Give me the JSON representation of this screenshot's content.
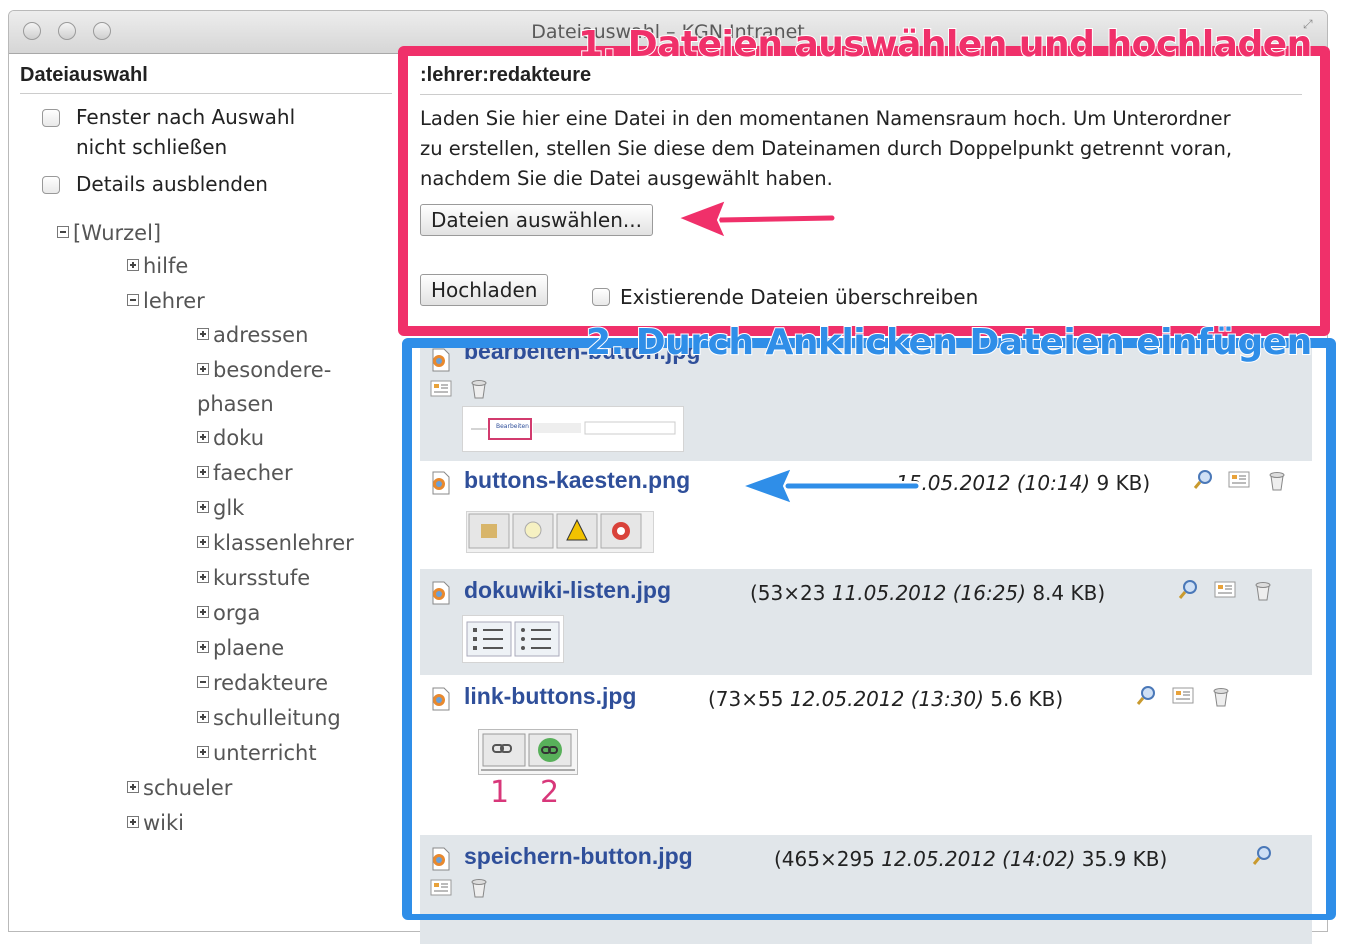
{
  "window": {
    "title": "Dateiauswahl – KGN Intranet"
  },
  "left": {
    "title": "Dateiauswahl",
    "options": [
      {
        "label_1": "Fenster nach Auswahl",
        "label_2": "nicht schließen"
      },
      {
        "label_1": "Details ausblenden"
      }
    ],
    "tree": {
      "root": "[Wurzel]",
      "hilfe": "hilfe",
      "lehrer": "lehrer",
      "lehrer_children": {
        "adressen": "adressen",
        "besondere_1": "besondere-",
        "besondere_2": "phasen",
        "doku": "doku",
        "faecher": "faecher",
        "glk": "glk",
        "klassenlehrer": "klassenlehrer",
        "kursstufe": "kursstufe",
        "orga": "orga",
        "plaene": "plaene",
        "redakteure": "redakteure",
        "schulleitung": "schulleitung",
        "unterricht": "unterricht"
      },
      "schueler": "schueler",
      "wiki": "wiki"
    }
  },
  "right": {
    "namespace": ":lehrer:redakteure",
    "desc": {
      "line1": "Laden Sie hier eine Datei in den momentanen Namensraum hoch. Um Unterordner",
      "line2": "zu erstellen, stellen Sie diese dem Dateinamen durch Doppelpunkt getrennt voran,",
      "line3": "nachdem Sie die Datei ausgewählt haben."
    },
    "select_button": "Dateien auswählen...",
    "upload_button": "Hochladen",
    "overwrite_label": "Existierende Dateien überschreiben"
  },
  "files": [
    {
      "name": "bearbeiten-button.jpg",
      "meta": ""
    },
    {
      "name": "buttons-kaesten.png",
      "meta_dims": "",
      "meta_date": "15.05.2012 (10:14)",
      "meta_size": "9 KB)"
    },
    {
      "name": "dokuwiki-listen.jpg",
      "meta_dims": "(53×23",
      "meta_date": "11.05.2012 (16:25)",
      "meta_size": "8.4 KB)"
    },
    {
      "name": "link-buttons.jpg",
      "meta_dims": "(73×55",
      "meta_date": "12.05.2012 (13:30)",
      "meta_size": "5.6 KB)",
      "labels": [
        "1",
        "2"
      ]
    },
    {
      "name": "speichern-button.jpg",
      "meta_dims": "(465×295",
      "meta_date": "12.05.2012 (14:02)",
      "meta_size": "35.9 KB)"
    }
  ],
  "thumbs": {
    "bearbeiten_label": "Bearbeiten"
  },
  "annotations": {
    "step1": "1. Dateien auswählen und hochladen",
    "step2": "2. Durch Anklicken Dateien einfügen",
    "pink": "#f0306a",
    "blue": "#2f8ee8"
  },
  "icons": [
    "file-image-icon",
    "magnifier-icon",
    "edit-icon",
    "delete-icon"
  ]
}
